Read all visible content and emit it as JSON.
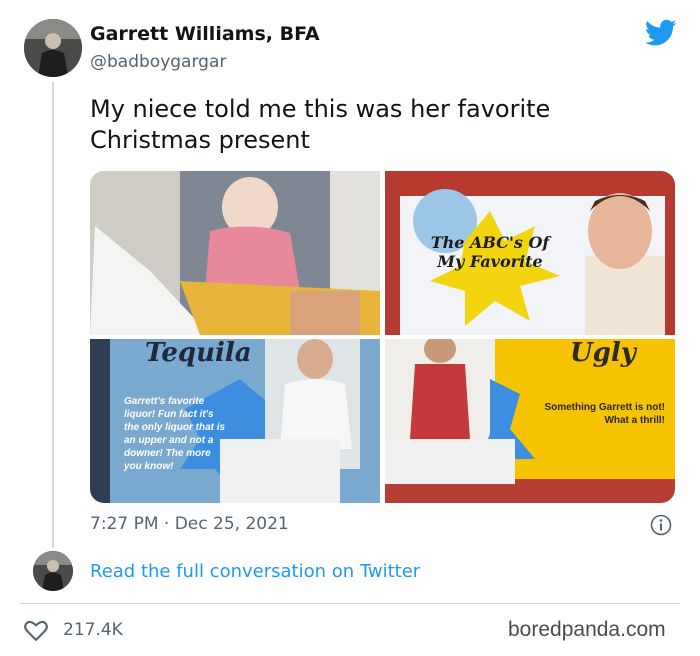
{
  "tweet": {
    "display_name": "Garrett Williams, BFA",
    "handle": "@badboygargar",
    "text": "My niece told me this was her favorite Christmas present",
    "timestamp": "7:27 PM · Dec 25, 2021",
    "read_link": "Read the full conversation on Twitter",
    "likes": "217.4K",
    "brand_color": "#1d9bf0"
  },
  "media": {
    "book_pages": [
      {
        "word": "Tequila",
        "caption": "Garrett's favorite liquor! Fun fact it's the only liquor that is an upper and not a downer! The more you know!"
      },
      {
        "word": "Ugly",
        "caption": "Something Garrett is not! What a thrill!"
      }
    ],
    "cover_title": "The ABC's Of My Favorite"
  },
  "icons": {
    "bird": "twitter-bird-icon",
    "info": "info-icon",
    "like": "heart-icon"
  },
  "watermark": "boredpanda.com"
}
